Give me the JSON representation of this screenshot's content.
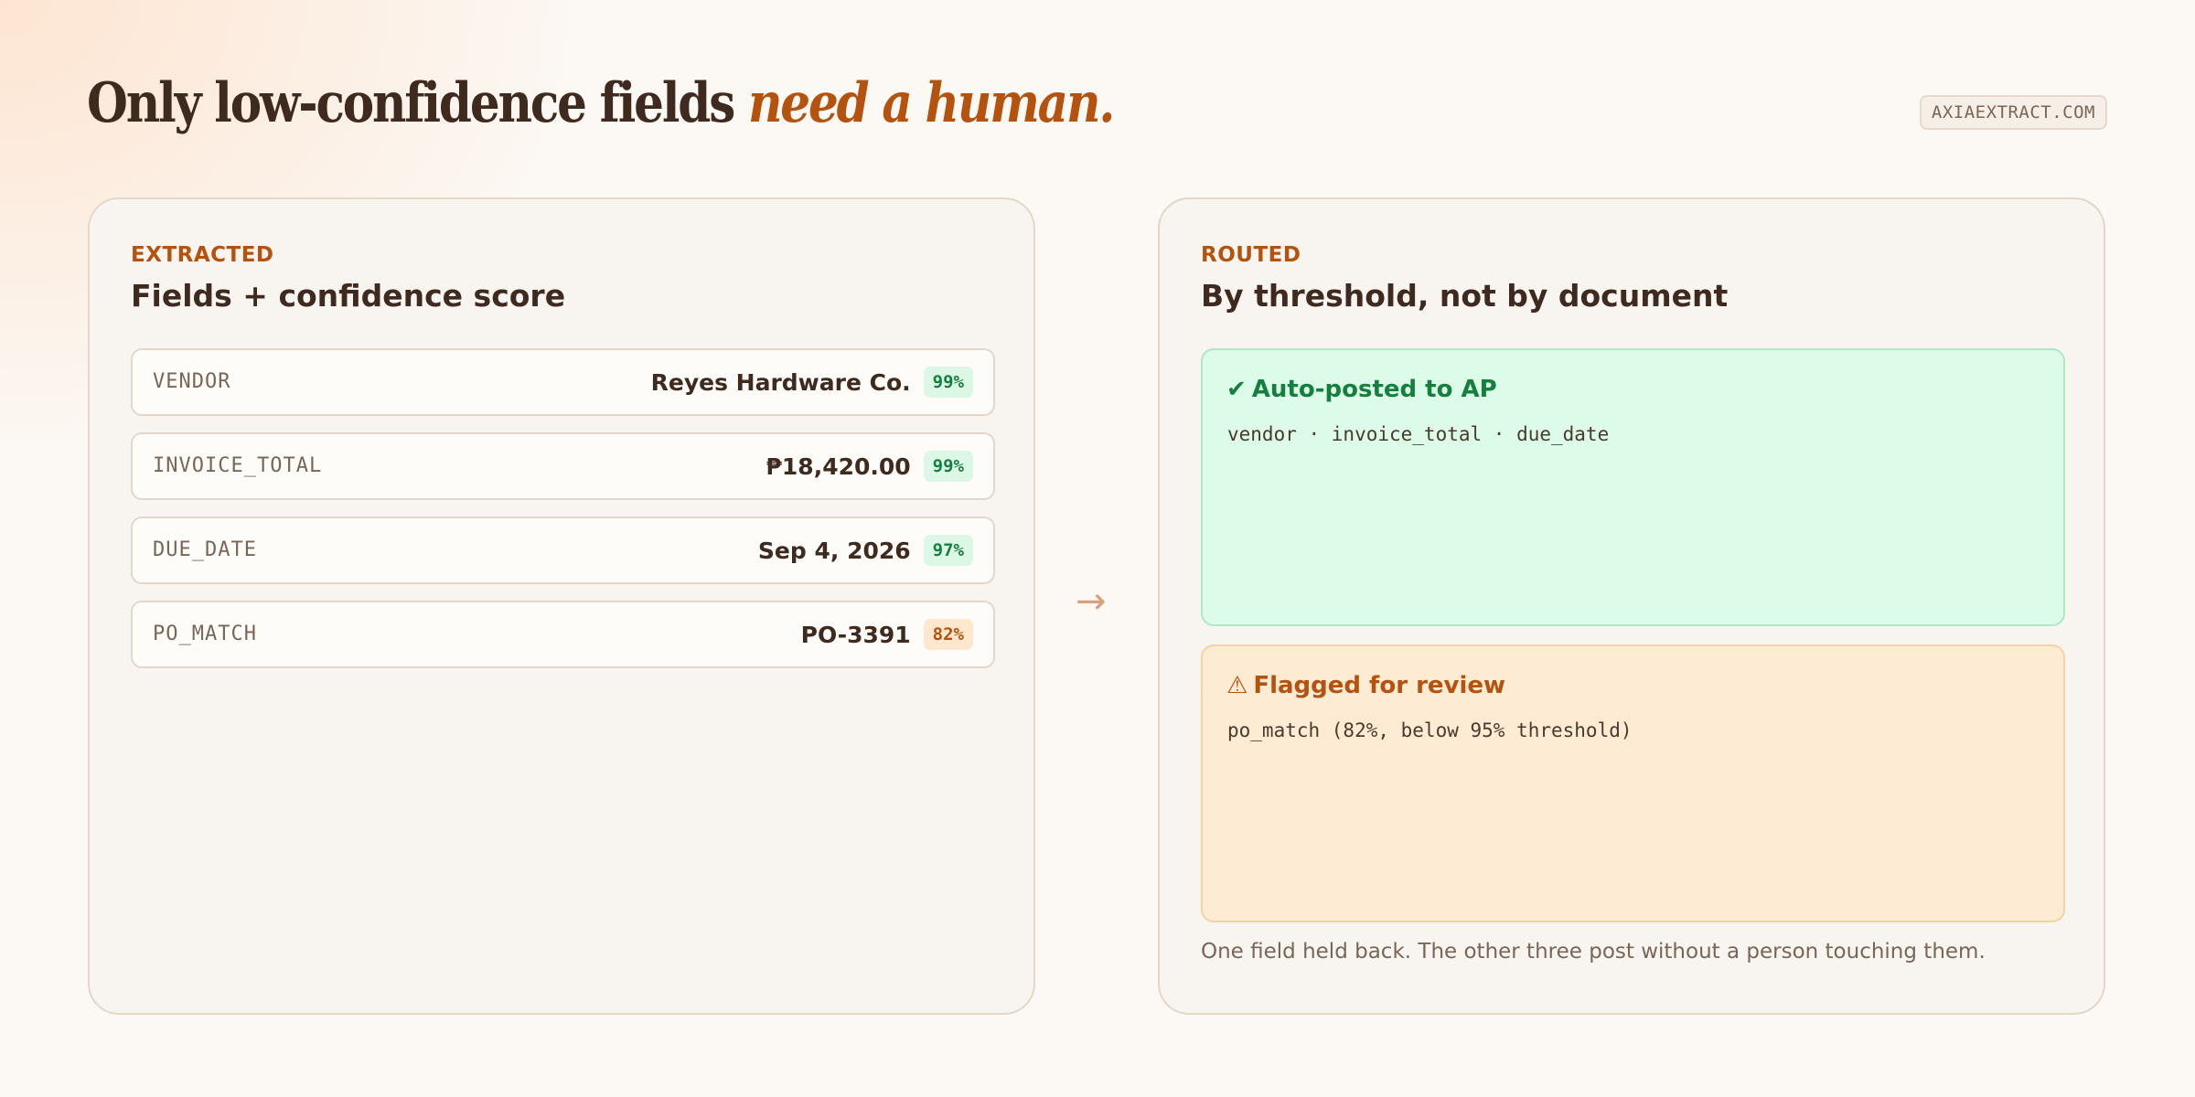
{
  "headline": {
    "text": "Only low-confidence fields ",
    "accent": "need a human."
  },
  "site_tag": "AXIAEXTRACT.COM",
  "extracted": {
    "eyebrow": "EXTRACTED",
    "title": "Fields + confidence score",
    "fields": [
      {
        "key": "VENDOR",
        "value": "Reyes Hardware Co.",
        "confidence": "99%",
        "level": "high"
      },
      {
        "key": "INVOICE_TOTAL",
        "value": "₱18,420.00",
        "confidence": "99%",
        "level": "high"
      },
      {
        "key": "DUE_DATE",
        "value": "Sep 4, 2026",
        "confidence": "97%",
        "level": "high"
      },
      {
        "key": "PO_MATCH",
        "value": "PO-3391",
        "confidence": "82%",
        "level": "low"
      }
    ]
  },
  "arrow": "→",
  "routed": {
    "eyebrow": "ROUTED",
    "title": "By threshold, not by document",
    "auto": {
      "icon": "check-icon",
      "glyph": "✔",
      "title": "Auto-posted to AP",
      "body": "vendor · invoice_total · due_date"
    },
    "flagged": {
      "icon": "warning-icon",
      "glyph": "⚠",
      "title": "Flagged for review",
      "body": "po_match (82%, below 95% threshold)"
    },
    "footnote": "One field held back. The other three post without a person touching them."
  },
  "colors": {
    "accent": "#b4520e",
    "text": "#3f2a1f",
    "success": "#15803d",
    "success_bg": "#dcfbe8",
    "warning_bg": "#feebd3"
  }
}
